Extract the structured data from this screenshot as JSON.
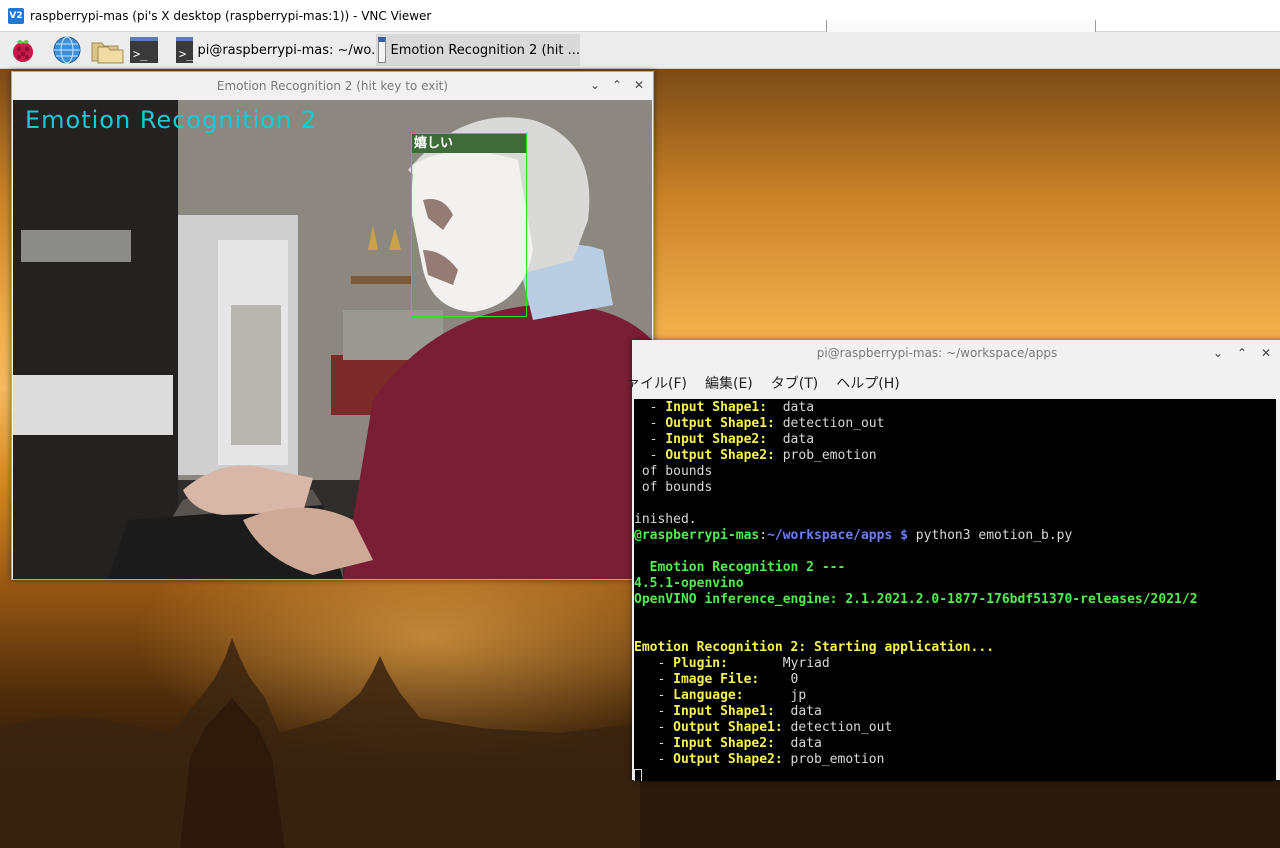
{
  "vnc": {
    "title": "raspberrypi-mas (pi's X desktop (raspberrypi-mas:1)) - VNC Viewer",
    "logo": "V2"
  },
  "taskbar": {
    "icons": [
      "raspberry-pi-menu-icon",
      "web-browser-globe-icon",
      "file-manager-folder-icon",
      "terminal-icon",
      "terminal-icon"
    ],
    "term_glyph": ">_",
    "tasks": [
      {
        "label": "pi@raspberrypi-mas: ~/wo..."
      },
      {
        "label": "Emotion Recognition 2  (hit ..."
      }
    ]
  },
  "emotion_window": {
    "title": "Emotion Recognition 2  (hit key to exit)",
    "controls": {
      "minimize": "⌄",
      "maximize": "⌃",
      "close": "✕"
    },
    "overlay_title": "Emotion Recognition 2",
    "face_label": "嬉しい",
    "colors": {
      "overlay": "#18c8d8",
      "face_box": "#2ee02e",
      "label_bg": "#3f6b3a"
    }
  },
  "terminal_window": {
    "title": "pi@raspberrypi-mas: ~/workspace/apps",
    "controls": {
      "minimize": "⌄",
      "maximize": "⌃",
      "close": "✕"
    },
    "menu": [
      "ァイル(F)",
      "編集(E)",
      "タブ(T)",
      "ヘルプ(H)"
    ],
    "lines": [
      [
        {
          "t": "  - ",
          "c": "w"
        },
        {
          "t": "Input Shape1:",
          "c": "y"
        },
        {
          "t": "  data",
          "c": "w"
        }
      ],
      [
        {
          "t": "  - ",
          "c": "w"
        },
        {
          "t": "Output Shape1:",
          "c": "y"
        },
        {
          "t": " detection_out",
          "c": "w"
        }
      ],
      [
        {
          "t": "  - ",
          "c": "w"
        },
        {
          "t": "Input Shape2:",
          "c": "y"
        },
        {
          "t": "  data",
          "c": "w"
        }
      ],
      [
        {
          "t": "  - ",
          "c": "w"
        },
        {
          "t": "Output Shape2:",
          "c": "y"
        },
        {
          "t": " prob_emotion",
          "c": "w"
        }
      ],
      [
        {
          "t": " of bounds",
          "c": "w"
        }
      ],
      [
        {
          "t": " of bounds",
          "c": "w"
        }
      ],
      [
        {
          "t": "",
          "c": "w"
        }
      ],
      [
        {
          "t": "inished.",
          "c": "w"
        }
      ],
      [
        {
          "t": "@raspberrypi-mas",
          "c": "g"
        },
        {
          "t": ":",
          "c": "w"
        },
        {
          "t": "~/workspace/apps $",
          "c": "b"
        },
        {
          "t": " python3 emotion_b.py",
          "c": "w"
        }
      ],
      [
        {
          "t": "",
          "c": "w"
        }
      ],
      [
        {
          "t": "  Emotion Recognition 2 ---",
          "c": "g"
        }
      ],
      [
        {
          "t": "4.5.1-openvino",
          "c": "g"
        }
      ],
      [
        {
          "t": "OpenVINO inference_engine: 2.1.2021.2.0-1877-176bdf51370-releases/2021/2",
          "c": "g"
        }
      ],
      [
        {
          "t": "",
          "c": "w"
        }
      ],
      [
        {
          "t": "",
          "c": "w"
        }
      ],
      [
        {
          "t": "Emotion Recognition 2: Starting application...",
          "c": "y"
        }
      ],
      [
        {
          "t": "   - ",
          "c": "w"
        },
        {
          "t": "Plugin:",
          "c": "y"
        },
        {
          "t": "       Myriad",
          "c": "w"
        }
      ],
      [
        {
          "t": "   - ",
          "c": "w"
        },
        {
          "t": "Image File:",
          "c": "y"
        },
        {
          "t": "    0",
          "c": "w"
        }
      ],
      [
        {
          "t": "   - ",
          "c": "w"
        },
        {
          "t": "Language:",
          "c": "y"
        },
        {
          "t": "      jp",
          "c": "w"
        }
      ],
      [
        {
          "t": "   - ",
          "c": "w"
        },
        {
          "t": "Input Shape1:",
          "c": "y"
        },
        {
          "t": "  data",
          "c": "w"
        }
      ],
      [
        {
          "t": "   - ",
          "c": "w"
        },
        {
          "t": "Output Shape1:",
          "c": "y"
        },
        {
          "t": " detection_out",
          "c": "w"
        }
      ],
      [
        {
          "t": "   - ",
          "c": "w"
        },
        {
          "t": "Input Shape2:",
          "c": "y"
        },
        {
          "t": "  data",
          "c": "w"
        }
      ],
      [
        {
          "t": "   - ",
          "c": "w"
        },
        {
          "t": "Output Shape2:",
          "c": "y"
        },
        {
          "t": " prob_emotion",
          "c": "w"
        }
      ]
    ]
  }
}
